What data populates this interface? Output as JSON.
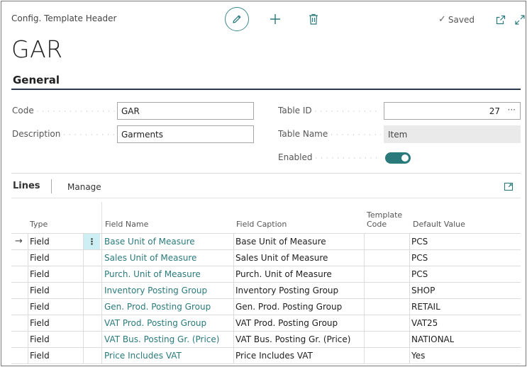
{
  "header": {
    "page_type": "Config. Template Header",
    "saved_label": "Saved",
    "title": "GAR"
  },
  "general": {
    "section_title": "General",
    "code_label": "Code",
    "code_value": "GAR",
    "description_label": "Description",
    "description_value": "Garments",
    "table_id_label": "Table ID",
    "table_id_value": "27",
    "table_name_label": "Table Name",
    "table_name_value": "Item",
    "enabled_label": "Enabled",
    "enabled": true
  },
  "lines": {
    "tab_label": "Lines",
    "manage_label": "Manage",
    "columns": {
      "type": "Type",
      "field_name": "Field Name",
      "field_caption": "Field Caption",
      "template_code_1": "Template",
      "template_code_2": "Code",
      "default_value": "Default Value"
    },
    "rows": [
      {
        "type": "Field",
        "field_name": "Base Unit of Measure",
        "field_caption": "Base Unit of Measure",
        "template_code": "",
        "default_value": "PCS"
      },
      {
        "type": "Field",
        "field_name": "Sales Unit of Measure",
        "field_caption": "Sales Unit of Measure",
        "template_code": "",
        "default_value": "PCS"
      },
      {
        "type": "Field",
        "field_name": "Purch. Unit of Measure",
        "field_caption": "Purch. Unit of Measure",
        "template_code": "",
        "default_value": "PCS"
      },
      {
        "type": "Field",
        "field_name": "Inventory Posting Group",
        "field_caption": "Inventory Posting Group",
        "template_code": "",
        "default_value": "SHOP"
      },
      {
        "type": "Field",
        "field_name": "Gen. Prod. Posting Group",
        "field_caption": "Gen. Prod. Posting Group",
        "template_code": "",
        "default_value": "RETAIL"
      },
      {
        "type": "Field",
        "field_name": "VAT Prod. Posting Group",
        "field_caption": "VAT Prod. Posting Group",
        "template_code": "",
        "default_value": "VAT25"
      },
      {
        "type": "Field",
        "field_name": "VAT Bus. Posting Gr. (Price)",
        "field_caption": "VAT Bus. Posting Gr. (Price)",
        "template_code": "",
        "default_value": "NATIONAL"
      },
      {
        "type": "Field",
        "field_name": "Price Includes VAT",
        "field_caption": "Price Includes VAT",
        "template_code": "",
        "default_value": "Yes"
      }
    ]
  },
  "colors": {
    "accent": "#2a7a7c",
    "selected_cell": "#cdeff3"
  }
}
